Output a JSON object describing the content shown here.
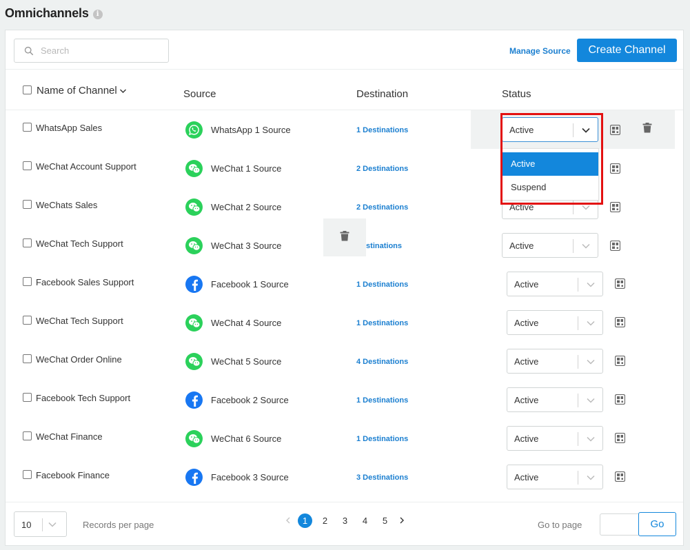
{
  "header": {
    "title": "Omnichannels",
    "info_glyph": "i"
  },
  "toolbar": {
    "search_placeholder": "Search",
    "manage_source_label": "Manage Source",
    "create_channel_label": "Create Channel"
  },
  "table": {
    "columns": {
      "name": "Name of Channel",
      "source": "Source",
      "destination": "Destination",
      "status": "Status"
    },
    "rows": [
      {
        "name": "WhatsApp Sales",
        "source_icon": "whatsapp-icon",
        "source": "WhatsApp 1 Source",
        "destination": "1 Destinations",
        "status": "Active"
      },
      {
        "name": "WeChat Account Support",
        "source_icon": "wechat-icon",
        "source": "WeChat 1 Source",
        "destination": "2 Destinations",
        "status": "Active"
      },
      {
        "name": "WeChats Sales",
        "source_icon": "wechat-icon",
        "source": "WeChat 2 Source",
        "destination": "2 Destinations",
        "status": "Active"
      },
      {
        "name": "WeChat Tech Support",
        "source_icon": "wechat-icon",
        "source": "WeChat 3 Source",
        "destination": "Destinations",
        "status": "Active"
      },
      {
        "name": "Facebook Sales Support",
        "source_icon": "facebook-icon",
        "source": "Facebook 1 Source",
        "destination": "1 Destinations",
        "status": "Active"
      },
      {
        "name": "WeChat Tech Support",
        "source_icon": "wechat-icon",
        "source": "WeChat 4 Source",
        "destination": "1 Destinations",
        "status": "Active"
      },
      {
        "name": "WeChat Order Online",
        "source_icon": "wechat-icon",
        "source": "WeChat 5 Source",
        "destination": "4 Destinations",
        "status": "Active"
      },
      {
        "name": "Facebook Tech Support",
        "source_icon": "facebook-icon",
        "source": "Facebook 2 Source",
        "destination": "1 Destinations",
        "status": "Active"
      },
      {
        "name": "WeChat Finance",
        "source_icon": "wechat-icon",
        "source": "WeChat 6 Source",
        "destination": "1 Destinations",
        "status": "Active"
      },
      {
        "name": "Facebook Finance",
        "source_icon": "facebook-icon",
        "source": "Facebook 3 Source",
        "destination": "3 Destinations",
        "status": "Active"
      }
    ]
  },
  "status_dropdown": {
    "options": [
      "Active",
      "Suspend"
    ],
    "selected": "Active"
  },
  "footer": {
    "per_page_value": "10",
    "records_per_page_label": "Records per page",
    "pages": [
      "1",
      "2",
      "3",
      "4",
      "5"
    ],
    "current_page": "1",
    "go_to_page_label": "Go to page",
    "go_label": "Go"
  },
  "colors": {
    "accent": "#1387dc",
    "link": "#1b7fd0",
    "highlight_box": "#e31010",
    "whatsapp": "#2bd15b",
    "wechat": "#2bd15b",
    "facebook": "#1877f2"
  }
}
